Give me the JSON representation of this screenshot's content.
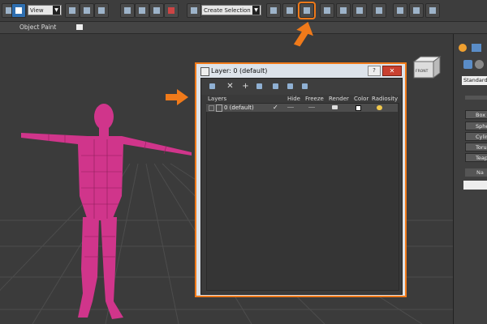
{
  "toolbar": {
    "view_dropdown": "View",
    "selection_set_dropdown": "Create Selection Se"
  },
  "ribbon": {
    "label": "Object Paint"
  },
  "dialog": {
    "title": "Layer: 0 (default)",
    "help": "?",
    "close": "✕",
    "columns": {
      "layers": "Layers",
      "hide": "Hide",
      "freeze": "Freeze",
      "render": "Render",
      "color": "Color",
      "radiosity": "Radiosity"
    },
    "rows": [
      {
        "name": "0 (default)",
        "checked": "✓"
      }
    ]
  },
  "command_panel": {
    "dropdown": "Standard P",
    "buttons": [
      "Box",
      "Spher",
      "Cylind",
      "Torus",
      "Teapo"
    ],
    "section2": "Na"
  },
  "viewcube": {
    "label": "FRONT"
  },
  "colors": {
    "accent": "#f07a1a",
    "mesh": "#d0358b",
    "close": "#c94030"
  }
}
